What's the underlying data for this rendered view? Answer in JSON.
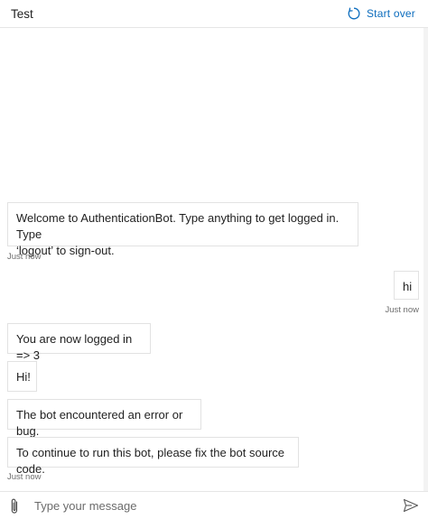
{
  "header": {
    "title": "Test",
    "start_over_label": "Start over",
    "start_over_icon": "refresh-icon",
    "accent_color": "#0b6cbd"
  },
  "messages": [
    {
      "from": "bot",
      "text_line1": "Welcome to AuthenticationBot. Type anything to get logged in. Type",
      "text_line2": "‘logout’ to sign-out.",
      "timestamp": "Just now"
    },
    {
      "from": "user",
      "text": "hi",
      "timestamp": "Just now"
    },
    {
      "from": "bot",
      "text": "You are now logged in => 3"
    },
    {
      "from": "bot",
      "text": "Hi!"
    },
    {
      "from": "bot",
      "text": "The bot encountered an error or bug."
    },
    {
      "from": "bot",
      "text": "To continue to run this bot, please fix the bot source code.",
      "timestamp": "Just now"
    }
  ],
  "composer": {
    "placeholder": "Type your message",
    "attach_icon": "paperclip-icon",
    "send_icon": "send-icon"
  }
}
